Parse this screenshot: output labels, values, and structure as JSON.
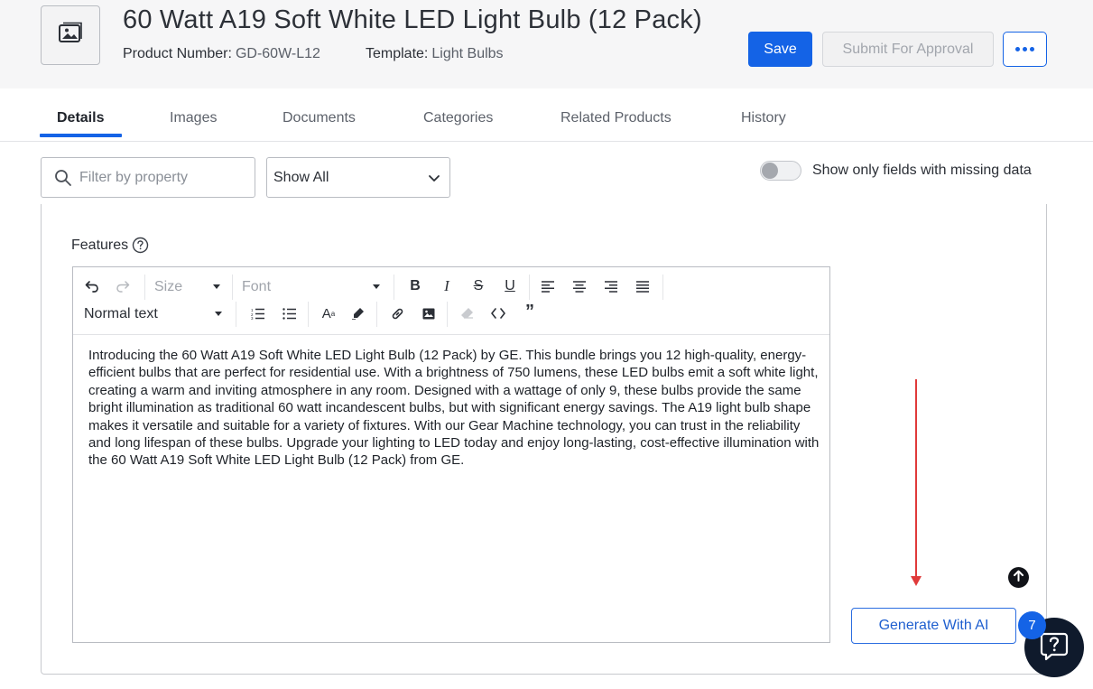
{
  "header": {
    "title": "60 Watt A19 Soft White LED Light Bulb (12 Pack)",
    "product_number_label": "Product Number:",
    "product_number_value": "GD-60W-L12",
    "template_label": "Template:",
    "template_value": "Light Bulbs",
    "thumbnail_icon": "image-icon",
    "save_label": "Save",
    "submit_label": "Submit For Approval",
    "more_icon": "ellipsis-icon",
    "primary_color": "#1463e6"
  },
  "tabs": [
    {
      "label": "Details",
      "active": true
    },
    {
      "label": "Images",
      "active": false
    },
    {
      "label": "Documents",
      "active": false
    },
    {
      "label": "Categories",
      "active": false
    },
    {
      "label": "Related Products",
      "active": false
    },
    {
      "label": "History",
      "active": false
    }
  ],
  "filters": {
    "search_placeholder": "Filter by property",
    "show_select_value": "Show All",
    "missing_toggle_label": "Show only fields with missing data",
    "missing_toggle_on": false
  },
  "field": {
    "label": "Features",
    "help_icon": "question-circle-icon"
  },
  "editor": {
    "size_placeholder": "Size",
    "font_placeholder": "Font",
    "paragraph_style": "Normal text",
    "content": "Introducing the 60 Watt A19 Soft White LED Light Bulb (12 Pack) by GE. This bundle brings you 12 high-quality, energy-efficient bulbs that are perfect for residential use. With a brightness of 750 lumens, these LED bulbs emit a soft white light, creating a warm and inviting atmosphere in any room. Designed with a wattage of only 9, these bulbs provide the same bright illumination as traditional 60 watt incandescent bulbs, but with significant energy savings. The A19 light bulb shape makes it versatile and suitable for a variety of fixtures. With our Gear Machine technology, you can trust in the reliability and long lifespan of these bulbs. Upgrade your lighting to LED today and enjoy long-lasting, cost-effective illumination with the 60 Watt A19 Soft White LED Light Bulb (12 Pack) from GE.",
    "toolbar_icons": [
      "undo-icon",
      "redo-icon",
      "bold-icon",
      "italic-icon",
      "strikethrough-icon",
      "underline-icon",
      "align-left-icon",
      "align-center-icon",
      "align-right-icon",
      "justify-icon",
      "ordered-list-icon",
      "unordered-list-icon",
      "font-size-icon",
      "highlighter-icon",
      "link-icon",
      "insert-image-icon",
      "eraser-icon",
      "code-icon",
      "quote-icon"
    ]
  },
  "actions": {
    "generate_label": "Generate With AI",
    "help_badge_count": "7",
    "annotation_color": "#e03a3a"
  }
}
